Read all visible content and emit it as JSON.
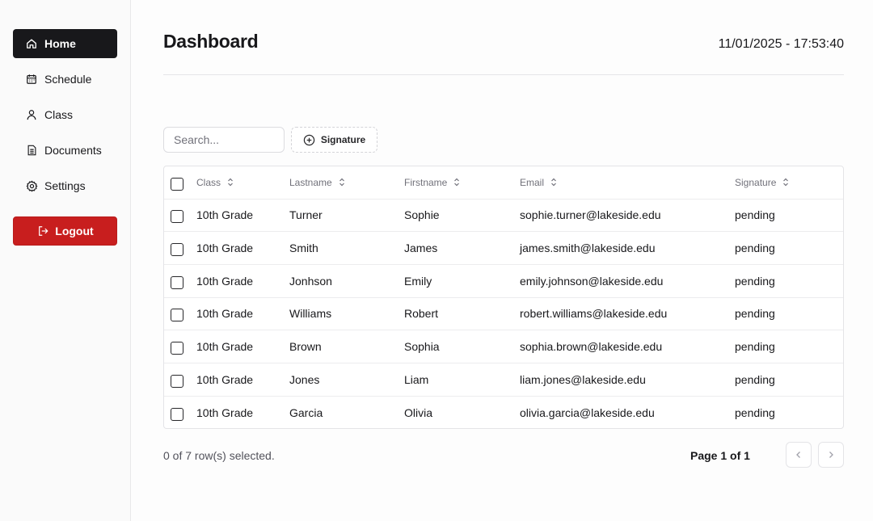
{
  "sidebar": {
    "items": [
      {
        "label": "Home",
        "icon": "home-icon",
        "active": true
      },
      {
        "label": "Schedule",
        "icon": "calendar-icon"
      },
      {
        "label": "Class",
        "icon": "user-icon"
      },
      {
        "label": "Documents",
        "icon": "document-icon"
      },
      {
        "label": "Settings",
        "icon": "gear-icon"
      }
    ],
    "logout_label": "Logout"
  },
  "header": {
    "title": "Dashboard",
    "datetime": "11/01/2025 - 17:53:40"
  },
  "toolbar": {
    "search_placeholder": "Search...",
    "signature_button_label": "Signature"
  },
  "table": {
    "columns": [
      "Class",
      "Lastname",
      "Firstname",
      "Email",
      "Signature"
    ],
    "rows": [
      {
        "class": "10th Grade",
        "lastname": "Turner",
        "firstname": "Sophie",
        "email": "sophie.turner@lakeside.edu",
        "signature": "pending"
      },
      {
        "class": "10th Grade",
        "lastname": "Smith",
        "firstname": "James",
        "email": "james.smith@lakeside.edu",
        "signature": "pending"
      },
      {
        "class": "10th Grade",
        "lastname": "Jonhson",
        "firstname": "Emily",
        "email": "emily.johnson@lakeside.edu",
        "signature": "pending"
      },
      {
        "class": "10th Grade",
        "lastname": "Williams",
        "firstname": "Robert",
        "email": "robert.williams@lakeside.edu",
        "signature": "pending"
      },
      {
        "class": "10th Grade",
        "lastname": "Brown",
        "firstname": "Sophia",
        "email": "sophia.brown@lakeside.edu",
        "signature": "pending"
      },
      {
        "class": "10th Grade",
        "lastname": "Jones",
        "firstname": "Liam",
        "email": "liam.jones@lakeside.edu",
        "signature": "pending"
      },
      {
        "class": "10th Grade",
        "lastname": "Garcia",
        "firstname": "Olivia",
        "email": "olivia.garcia@lakeside.edu",
        "signature": "pending"
      }
    ]
  },
  "footer": {
    "selection_text": "0 of 7 row(s) selected.",
    "page_text": "Page 1 of 1"
  },
  "colors": {
    "active_nav": "#18181b",
    "logout": "#c81e1e"
  }
}
